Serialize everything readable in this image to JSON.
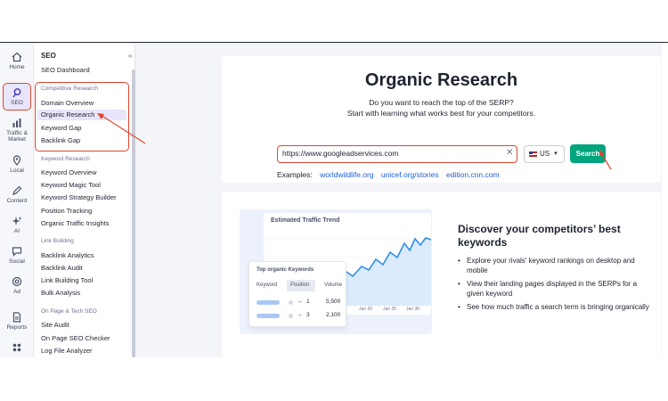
{
  "rail": {
    "items": [
      {
        "label": "Home",
        "icon": "home-icon"
      },
      {
        "label": "SEO",
        "icon": "seo-icon"
      },
      {
        "label": "Traffic & Market",
        "icon": "traffic-icon"
      },
      {
        "label": "Local",
        "icon": "location-pin-icon"
      },
      {
        "label": "Content",
        "icon": "pen-icon"
      },
      {
        "label": "AI",
        "icon": "sparkle-icon"
      },
      {
        "label": "Social",
        "icon": "chat-icon"
      },
      {
        "label": "Ad",
        "icon": "target-icon"
      },
      {
        "label": "Reports",
        "icon": "document-icon"
      },
      {
        "label": "",
        "icon": "apps-grid-icon"
      }
    ]
  },
  "sidebar": {
    "title": "SEO",
    "dashboard": "SEO Dashboard",
    "competitive_header": "Competitive Research",
    "competitive": [
      "Domain Overview",
      "Organic Research",
      "Keyword Gap",
      "Backlink Gap"
    ],
    "keyword_header": "Keyword Research",
    "keyword": [
      "Keyword Overview",
      "Keyword Magic Tool",
      "Keyword Strategy Builder",
      "Position Tracking",
      "Organic Traffic Insights"
    ],
    "link_header": "Link Building",
    "link": [
      "Backlink Analytics",
      "Backlink Audit",
      "Link Building Tool",
      "Bulk Analysis"
    ],
    "onpage_header": "On Page & Tech SEO",
    "onpage": [
      "Site Audit",
      "On Page SEO Checker",
      "Log File Analyzer"
    ]
  },
  "search": {
    "title": "Organic Research",
    "subtitle1": "Do you want to reach the top of the SERP?",
    "subtitle2": "Start with learning what works best for your competitors.",
    "url_value": "https://www.googleadservices.com",
    "db_value": "US",
    "button": "Search",
    "examples_label": "Examples:",
    "examples": [
      "worldwildlife.org",
      "unicef.org/stories",
      "edition.cnn.com"
    ]
  },
  "promo": {
    "trend_title": "Estimated Traffic Trend",
    "kw_title": "Top organic Keywords",
    "kw_cols": [
      "Keyword",
      "Position",
      "Volume"
    ],
    "kw_rows": [
      {
        "from": "",
        "to": "1",
        "volume": "5,500"
      },
      {
        "from": "",
        "to": "3",
        "volume": "2,100"
      }
    ],
    "ticks": [
      "Jan 20",
      "Jan 25",
      "Jan 30"
    ],
    "heading": "Discover your competitors’ best keywords",
    "bullets": [
      "Explore your rivals' keyword rankings on desktop and mobile",
      "View their landing pages displayed in the SERPs for a given keyword",
      "See how much traffic a search term is bringing organically"
    ]
  },
  "colors": {
    "accent_red": "#e1452f",
    "search_green": "#00a47d",
    "link_blue": "#1e61d6",
    "active_purple": "#e9e5fb"
  }
}
